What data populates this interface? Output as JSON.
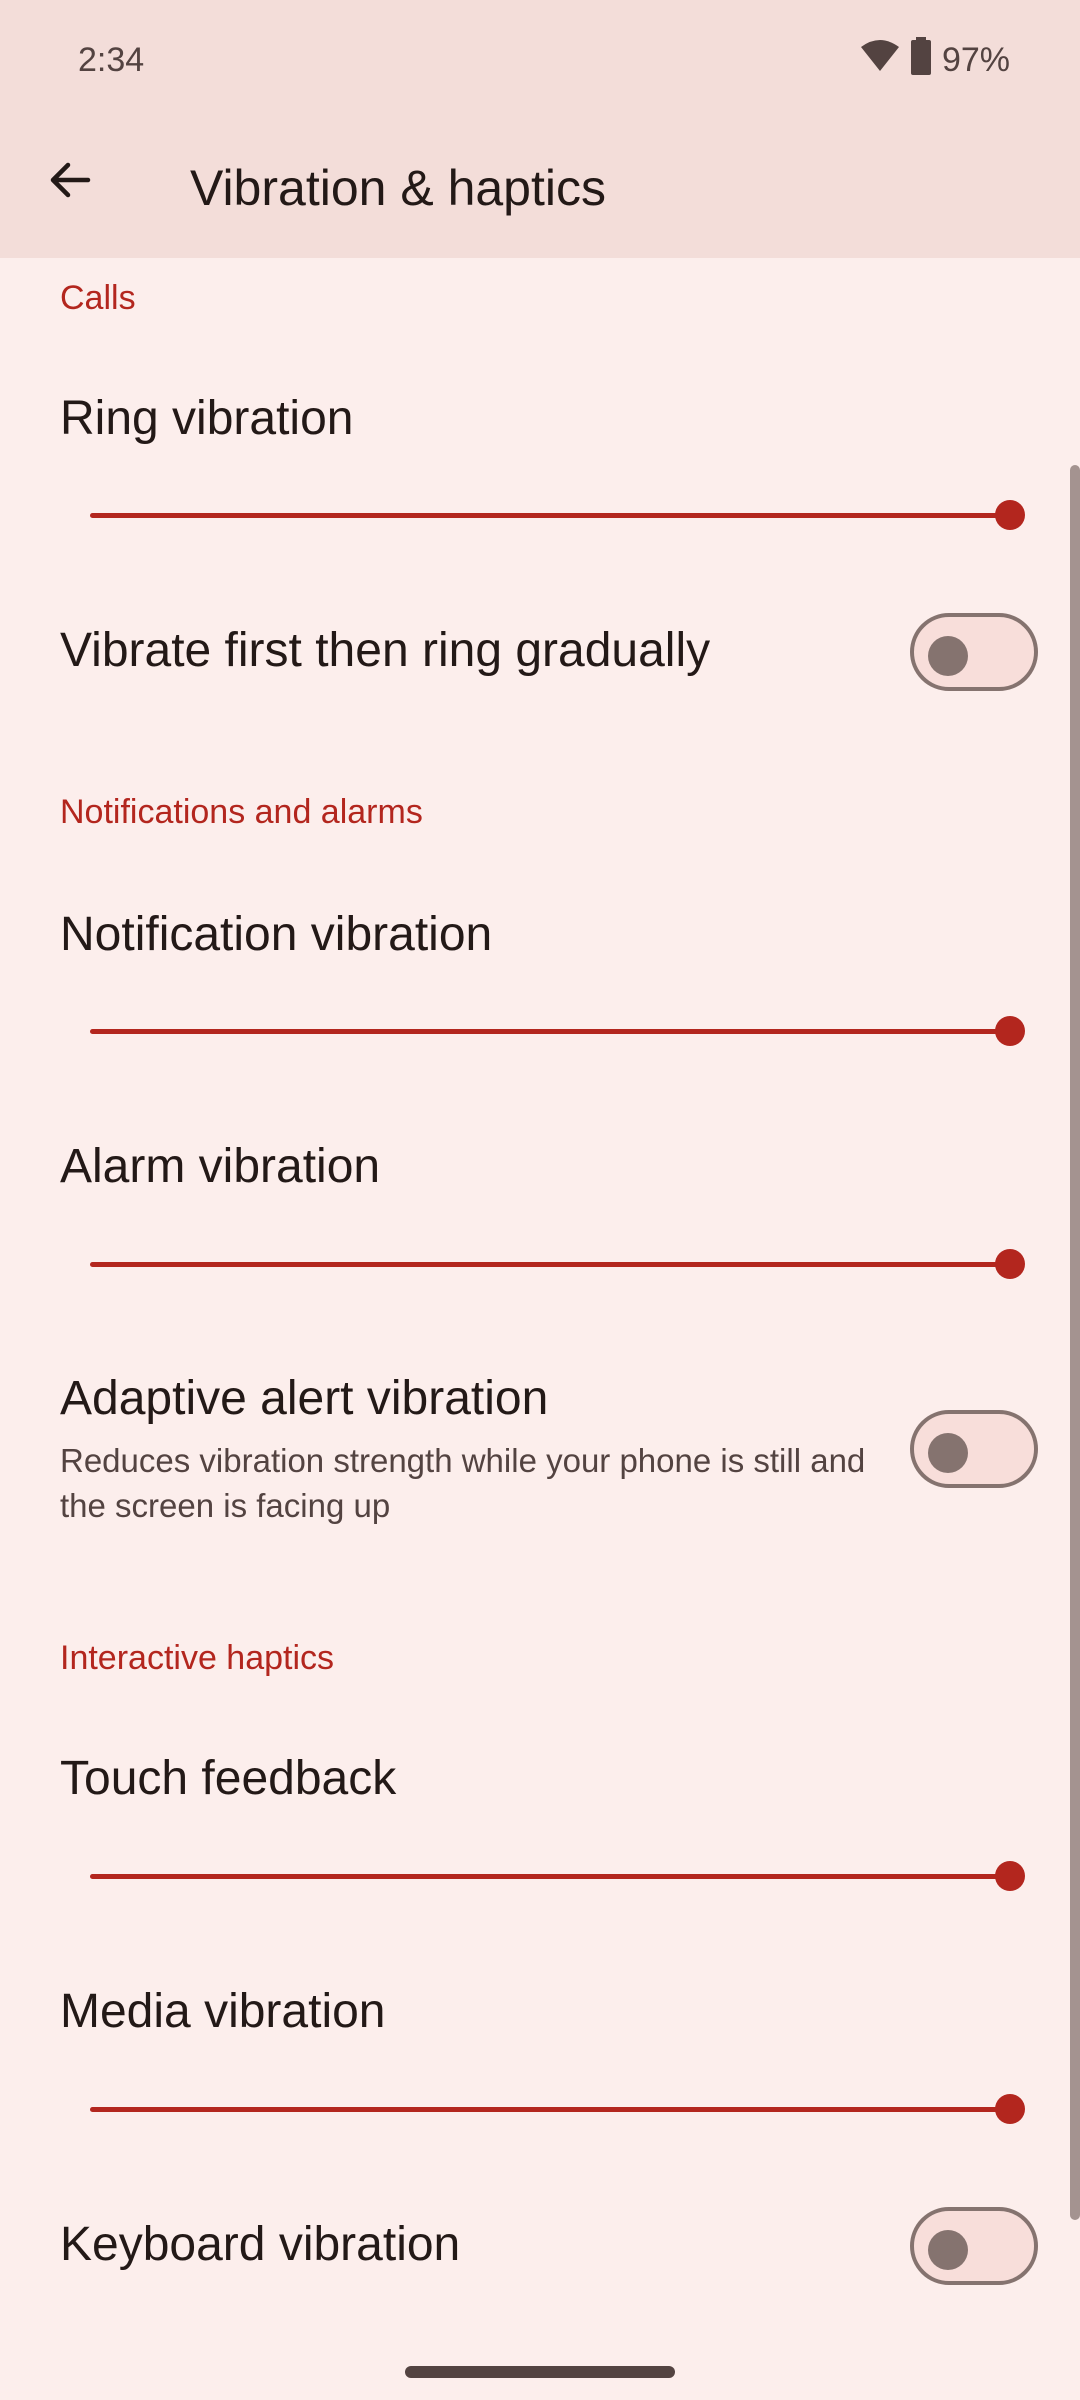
{
  "status_bar": {
    "time": "2:34",
    "battery": "97%",
    "icons": [
      "wifi-icon",
      "battery-icon"
    ]
  },
  "app_bar": {
    "back_icon": "arrow-back-icon",
    "title": "Vibration & haptics"
  },
  "sections": {
    "calls": {
      "header": "Calls",
      "ring_vibration": {
        "title": "Ring vibration",
        "level": 1.0
      },
      "vibrate_first": {
        "title": "Vibrate first then ring gradually",
        "on": false
      }
    },
    "notifications": {
      "header": "Notifications and alarms",
      "notification_vibration": {
        "title": "Notification vibration",
        "level": 1.0
      },
      "alarm_vibration": {
        "title": "Alarm vibration",
        "level": 1.0
      },
      "adaptive_alert": {
        "title": "Adaptive alert vibration",
        "summary": "Reduces vibration strength while your phone is still and the screen is facing up",
        "on": false
      }
    },
    "haptics": {
      "header": "Interactive haptics",
      "touch_feedback": {
        "title": "Touch feedback",
        "level": 1.0
      },
      "media_vibration": {
        "title": "Media vibration",
        "level": 1.0
      },
      "keyboard_vibration": {
        "title": "Keyboard vibration",
        "on": false
      }
    }
  },
  "colors": {
    "accent": "#B3261E",
    "background": "#FCEEEC",
    "top_bar": "#F3DDD9"
  }
}
